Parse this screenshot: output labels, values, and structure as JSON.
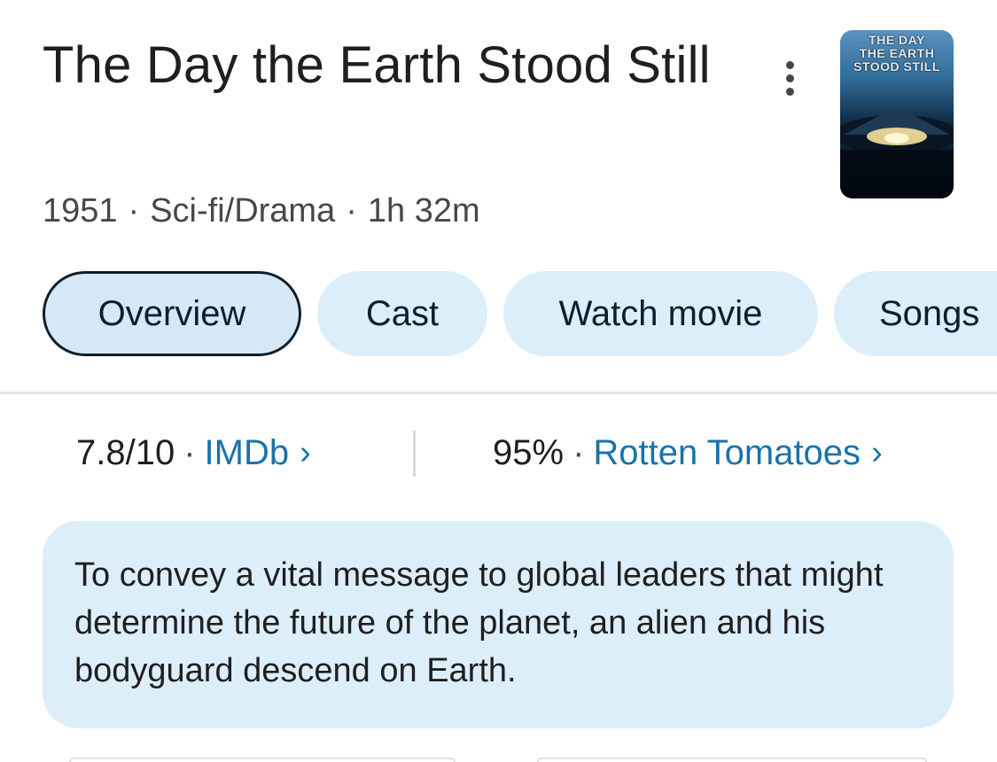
{
  "movie": {
    "title": "The Day the Earth Stood Still",
    "year": "1951",
    "genre": "Sci-fi/Drama",
    "runtime": "1h 32m",
    "separator": "·",
    "poster_text": [
      "THE DAY",
      "THE EARTH",
      "STOOD STILL"
    ]
  },
  "tabs": [
    {
      "label": "Overview",
      "active": true
    },
    {
      "label": "Cast",
      "active": false
    },
    {
      "label": "Watch movie",
      "active": false
    },
    {
      "label": "Songs",
      "active": false
    }
  ],
  "ratings": {
    "imdb": {
      "score": "7.8/10",
      "source": "IMDb",
      "chevron": "›"
    },
    "rt": {
      "score": "95%",
      "source": "Rotten Tomatoes",
      "chevron": "›"
    }
  },
  "description": "To convey a vital message to global leaders that might determine the future of the planet, an alien and his bodyguard descend on Earth.",
  "colors": {
    "chip_bg": "#ddeefb",
    "link": "#1a73a8",
    "text": "#1f1f1f"
  },
  "icons": {
    "more": "vertical-dots-icon"
  }
}
